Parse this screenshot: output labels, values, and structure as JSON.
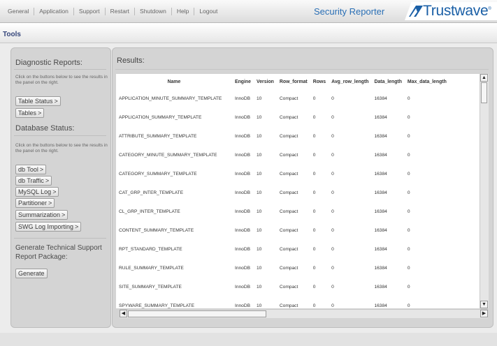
{
  "top_nav": {
    "items": [
      "General",
      "Application",
      "Support",
      "Restart",
      "Shutdown",
      "Help",
      "Logout"
    ]
  },
  "app_title": "Security Reporter",
  "brand": {
    "name": "Trustwave",
    "mark": "®",
    "color": "#1a5fa6"
  },
  "tools": {
    "label": "Tools"
  },
  "left_panel": {
    "diagnostic": {
      "heading": "Diagnostic Reports:",
      "hint": "Click on the buttons below to see the results in the panel on the right.",
      "buttons": [
        "Table Status",
        "Tables"
      ]
    },
    "database": {
      "heading": "Database Status:",
      "hint": "Click on the buttons below to see the results in the panel on the right.",
      "buttons": [
        "db Tool",
        "db Traffic",
        "MySQL Log",
        "Partitioner",
        "Summarization",
        "SWG Log Importing"
      ]
    },
    "support": {
      "heading": "Generate Technical Support Report Package:",
      "button": "Generate"
    },
    "chevron": ">"
  },
  "results": {
    "title": "Results:",
    "columns": [
      "Name",
      "Engine",
      "Version",
      "Row_format",
      "Rows",
      "Avg_row_length",
      "Data_length",
      "Max_data_length"
    ],
    "rows": [
      [
        "APPLICATION_MINUTE_SUMMARY_TEMPLATE",
        "InnoDB",
        "10",
        "Compact",
        "0",
        "0",
        "16384",
        "0"
      ],
      [
        "APPLICATION_SUMMARY_TEMPLATE",
        "InnoDB",
        "10",
        "Compact",
        "0",
        "0",
        "16384",
        "0"
      ],
      [
        "ATTRIBUTE_SUMMARY_TEMPLATE",
        "InnoDB",
        "10",
        "Compact",
        "0",
        "0",
        "16384",
        "0"
      ],
      [
        "CATEGORY_MINUTE_SUMMARY_TEMPLATE",
        "InnoDB",
        "10",
        "Compact",
        "0",
        "0",
        "16384",
        "0"
      ],
      [
        "CATEGORY_SUMMARY_TEMPLATE",
        "InnoDB",
        "10",
        "Compact",
        "0",
        "0",
        "16384",
        "0"
      ],
      [
        "CAT_GRP_INTER_TEMPLATE",
        "InnoDB",
        "10",
        "Compact",
        "0",
        "0",
        "16384",
        "0"
      ],
      [
        "CL_GRP_INTER_TEMPLATE",
        "InnoDB",
        "10",
        "Compact",
        "0",
        "0",
        "16384",
        "0"
      ],
      [
        "CONTENT_SUMMARY_TEMPLATE",
        "InnoDB",
        "10",
        "Compact",
        "0",
        "0",
        "16384",
        "0"
      ],
      [
        "RPT_STANDARD_TEMPLATE",
        "InnoDB",
        "10",
        "Compact",
        "0",
        "0",
        "16384",
        "0"
      ],
      [
        "RULE_SUMMARY_TEMPLATE",
        "InnoDB",
        "10",
        "Compact",
        "0",
        "0",
        "16384",
        "0"
      ],
      [
        "SITE_SUMMARY_TEMPLATE",
        "InnoDB",
        "10",
        "Compact",
        "0",
        "0",
        "16384",
        "0"
      ],
      [
        "SPYWARE_SUMMARY_TEMPLATE",
        "InnoDB",
        "10",
        "Compact",
        "0",
        "0",
        "16384",
        "0"
      ]
    ]
  }
}
